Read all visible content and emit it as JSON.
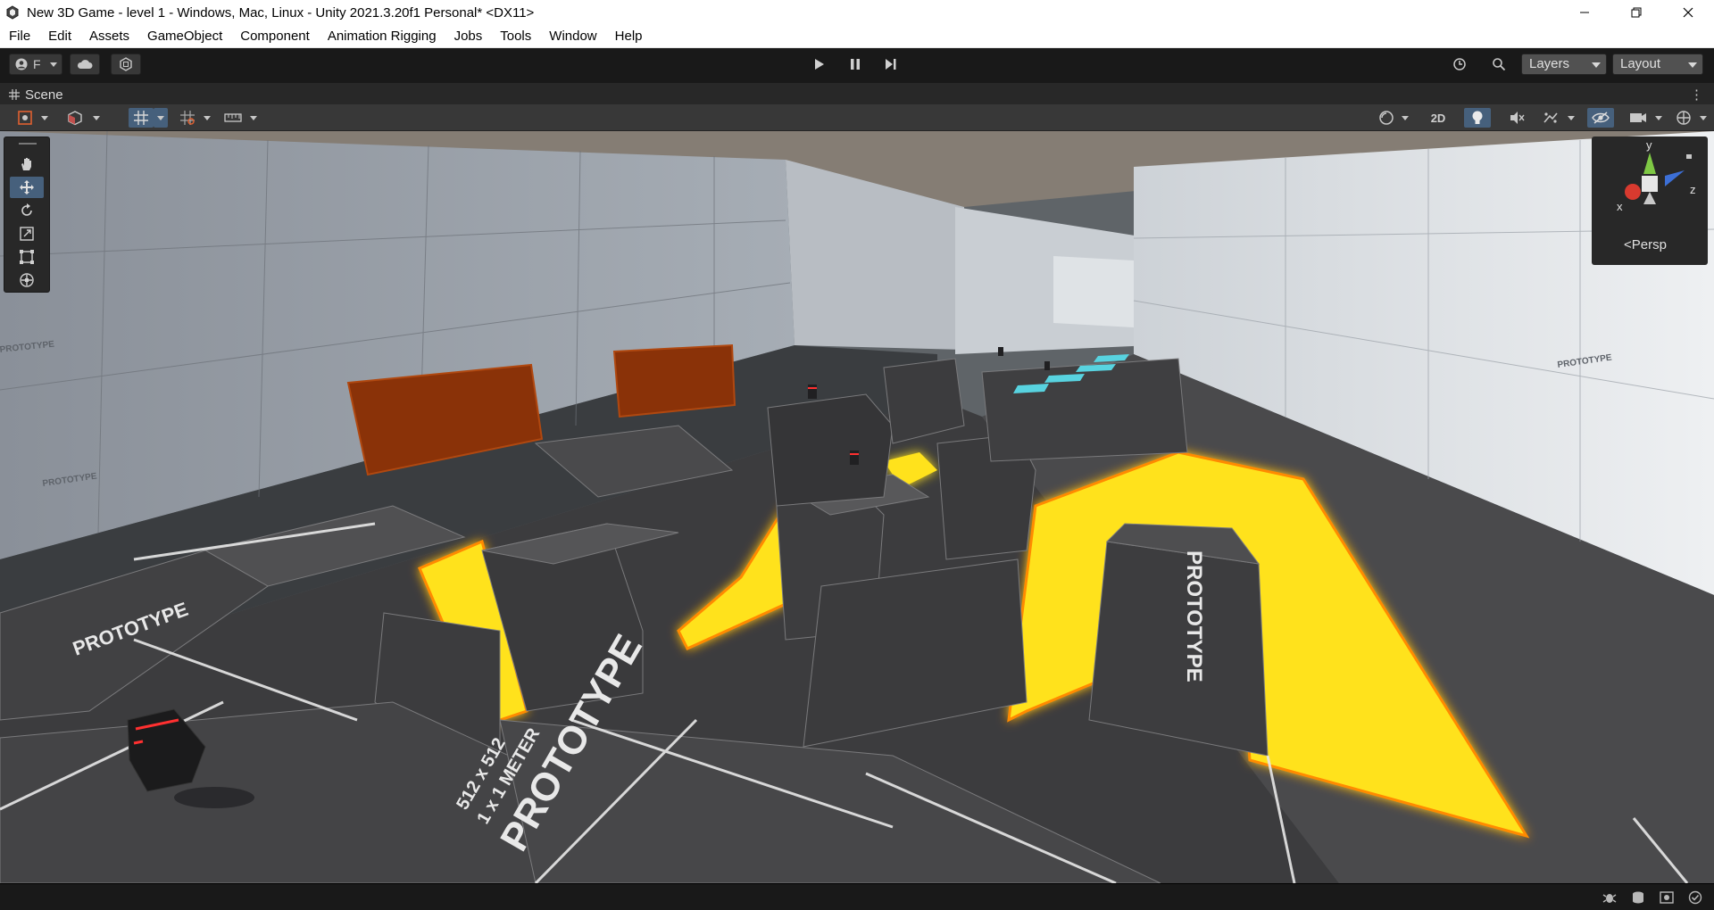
{
  "window": {
    "title": "New 3D Game - level 1 - Windows, Mac, Linux - Unity 2021.3.20f1 Personal* <DX11>"
  },
  "menu": [
    "File",
    "Edit",
    "Assets",
    "GameObject",
    "Component",
    "Animation Rigging",
    "Jobs",
    "Tools",
    "Window",
    "Help"
  ],
  "toolbar": {
    "account_label": "F",
    "layers_label": "Layers",
    "layout_label": "Layout"
  },
  "scene": {
    "tab_label": "Scene",
    "btn_2d_label": "2D",
    "gizmo": {
      "projection_label": "Persp",
      "axis_x": "x",
      "axis_y": "y",
      "axis_z": "z"
    }
  },
  "viewport_text": {
    "prototype": "PROTOTYPE",
    "meter": "1 x 1 METER",
    "size": "512 x 512"
  },
  "colors": {
    "lava": "#ffe21a",
    "lava_glow": "#ff7a00",
    "orange_panel": "#8a3208",
    "platform": "#3d3d3f",
    "wall": "#b8bec6",
    "selection_blue": "#46607c",
    "cyan_platform": "#58d3e0"
  }
}
